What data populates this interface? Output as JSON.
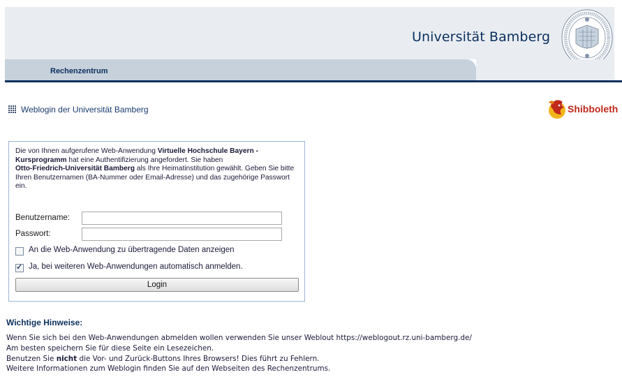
{
  "header": {
    "university_name": "Universität Bamberg",
    "nav_item": "Rechenzentrum"
  },
  "title": {
    "text": "Weblogin der Universität Bamberg",
    "shibboleth_label": "Shibboleth"
  },
  "login": {
    "intro": {
      "part1": "Die von Ihnen aufgerufene Web-Anwendung ",
      "app_name": "Virtuelle Hochschule Bayern - Kursprogramm",
      "part2": " hat eine Authentifizierung angefordert. Sie haben ",
      "institution": "Otto-Friedrich-Universität Bamberg",
      "part3": " als Ihre Heimatinstitution gewählt. Geben Sie bitte Ihren Benutzernamen (BA-Nummer oder Email-Adresse) und das zugehörige Passwort ein."
    },
    "username_label": "Benutzername:",
    "username_value": "",
    "password_label": "Passwort:",
    "password_value": "",
    "show_data_label": "An die Web-Anwendung zu übertragende Daten anzeigen",
    "show_data_checked": false,
    "auto_login_label": "Ja, bei weiteren Web-Anwendungen automatisch anmelden.",
    "auto_login_checked": true,
    "login_button": "Login"
  },
  "notes": {
    "heading": "Wichtige Hinweise:",
    "line1": "Wenn Sie sich bei den Web-Anwendungen abmelden wollen verwenden Sie unser Weblout https://weblogout.rz.uni-bamberg.de/",
    "line2": "Am besten speichern Sie für diese Seite ein Lesezeichen.",
    "line3_pre": "Benutzen Sie ",
    "line3_bold": "nicht",
    "line3_post": " die Vor- und Zurück-Buttons Ihres Browsers! Dies führt zu Fehlern.",
    "line4": "Weitere Informationen zum Weblogin finden Sie auf den Webseiten des Rechenzentrums."
  },
  "colors": {
    "primary": "#0b2f5c",
    "header_bg": "#e9edf2",
    "nav_bg": "#c6d1dc",
    "shibboleth_red": "#c0281c"
  }
}
